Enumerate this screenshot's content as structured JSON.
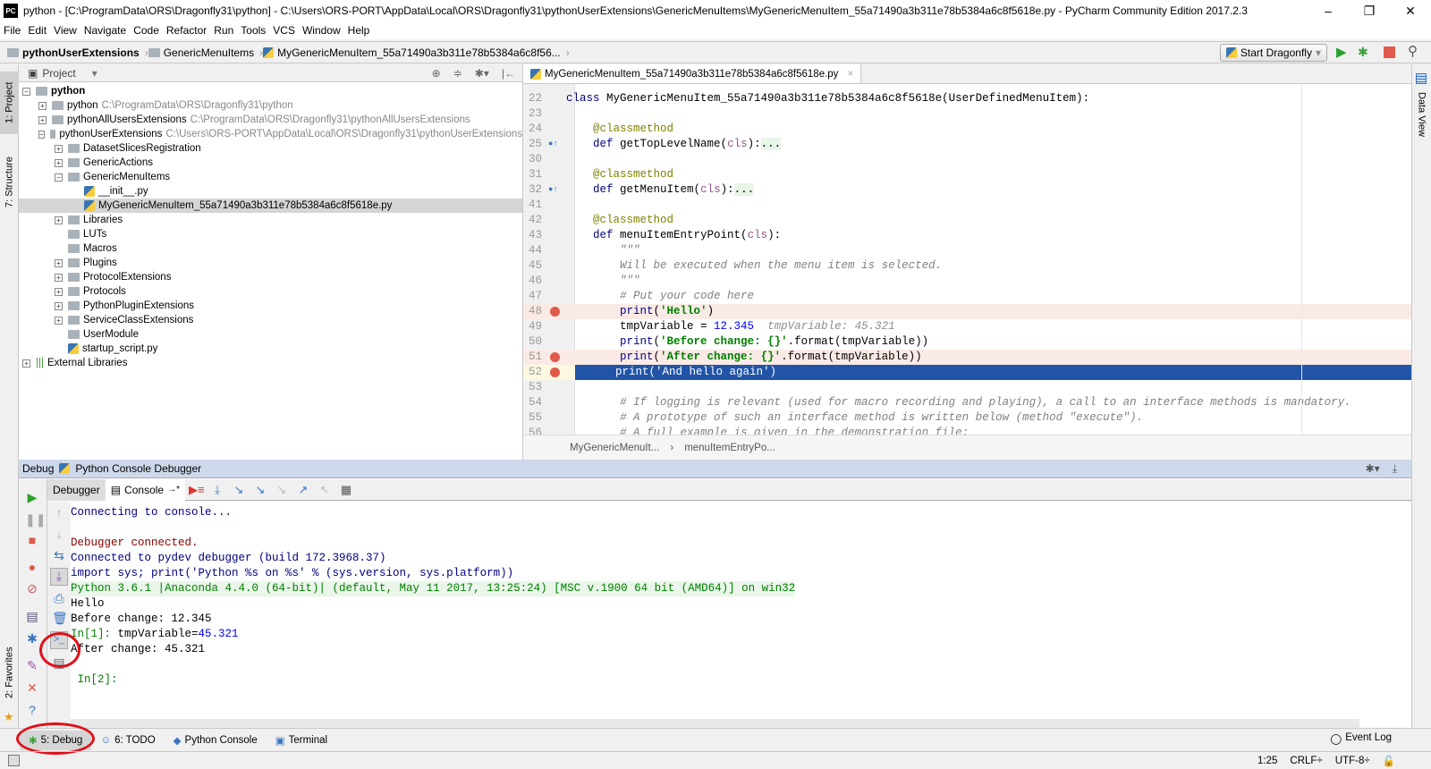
{
  "window": {
    "title": "python - [C:\\ProgramData\\ORS\\Dragonfly31\\python] - C:\\Users\\ORS-PORT\\AppData\\Local\\ORS\\Dragonfly31\\pythonUserExtensions\\GenericMenuItems\\MyGenericMenuItem_55a71490a3b311e78b5384a6c8f5618e.py - PyCharm Community Edition 2017.2.3",
    "logo": "PC",
    "minimize": "–",
    "maximize": "❐",
    "close": "✕"
  },
  "menu": [
    "File",
    "Edit",
    "View",
    "Navigate",
    "Code",
    "Refactor",
    "Run",
    "Tools",
    "VCS",
    "Window",
    "Help"
  ],
  "breadcrumb": [
    "pythonUserExtensions",
    "GenericMenuItems",
    "MyGenericMenuItem_55a71490a3b311e78b5384a6c8f56..."
  ],
  "run_config": {
    "label": "Start Dragonfly"
  },
  "left_strip": {
    "project": "1: Project",
    "structure": "7: Structure",
    "favorites": "2: Favorites"
  },
  "right_strip": {
    "data_view": "Data View"
  },
  "project": {
    "header": "Project",
    "tree": [
      {
        "label": "python",
        "path": "",
        "toggle": "−",
        "depth": 0,
        "bold": true
      },
      {
        "label": "python",
        "path": "C:\\ProgramData\\ORS\\Dragonfly31\\python",
        "toggle": "+",
        "depth": 1
      },
      {
        "label": "pythonAllUsersExtensions",
        "path": "C:\\ProgramData\\ORS\\Dragonfly31\\pythonAllUsersExtensions",
        "toggle": "+",
        "depth": 1
      },
      {
        "label": "pythonUserExtensions",
        "path": "C:\\Users\\ORS-PORT\\AppData\\Local\\ORS\\Dragonfly31\\pythonUserExtensions",
        "toggle": "−",
        "depth": 1
      },
      {
        "label": "DatasetSlicesRegistration",
        "path": "",
        "toggle": "+",
        "depth": 2
      },
      {
        "label": "GenericActions",
        "path": "",
        "toggle": "+",
        "depth": 2
      },
      {
        "label": "GenericMenuItems",
        "path": "",
        "toggle": "−",
        "depth": 2
      },
      {
        "label": "__init__.py",
        "path": "",
        "toggle": "",
        "depth": 3,
        "file": true
      },
      {
        "label": "MyGenericMenuItem_55a71490a3b311e78b5384a6c8f5618e.py",
        "path": "",
        "toggle": "",
        "depth": 3,
        "file": true,
        "selected": true
      },
      {
        "label": "Libraries",
        "path": "",
        "toggle": "+",
        "depth": 2
      },
      {
        "label": "LUTs",
        "path": "",
        "toggle": "",
        "depth": 2
      },
      {
        "label": "Macros",
        "path": "",
        "toggle": "",
        "depth": 2
      },
      {
        "label": "Plugins",
        "path": "",
        "toggle": "+",
        "depth": 2
      },
      {
        "label": "ProtocolExtensions",
        "path": "",
        "toggle": "+",
        "depth": 2
      },
      {
        "label": "Protocols",
        "path": "",
        "toggle": "+",
        "depth": 2
      },
      {
        "label": "PythonPluginExtensions",
        "path": "",
        "toggle": "+",
        "depth": 2
      },
      {
        "label": "ServiceClassExtensions",
        "path": "",
        "toggle": "+",
        "depth": 2
      },
      {
        "label": "UserModule",
        "path": "",
        "toggle": "",
        "depth": 2
      },
      {
        "label": "startup_script.py",
        "path": "",
        "toggle": "",
        "depth": 2,
        "file": true
      },
      {
        "label": "External Libraries",
        "path": "",
        "toggle": "+",
        "depth": 0,
        "lib": true
      }
    ]
  },
  "editor": {
    "tab": "MyGenericMenuItem_55a71490a3b311e78b5384a6c8f5618e.py",
    "lines": [
      {
        "n": "22",
        "html": "<span class='kw'>class</span> MyGenericMenuItem_55a71490a3b311e78b5384a6c8f5618e(UserDefinedMenuItem):"
      },
      {
        "n": "23",
        "html": ""
      },
      {
        "n": "24",
        "html": "    <span class='dec'>@classmethod</span>"
      },
      {
        "n": "25",
        "html": "    <span class='kw'>def</span> getTopLevelName(<span class='cls'>cls</span>):<span style='background:#e8f5e8'>...</span>",
        "mark": "override"
      },
      {
        "n": "30",
        "html": ""
      },
      {
        "n": "31",
        "html": "    <span class='dec'>@classmethod</span>"
      },
      {
        "n": "32",
        "html": "    <span class='kw'>def</span> getMenuItem(<span class='cls'>cls</span>):<span style='background:#e8f5e8'>...</span>",
        "mark": "override"
      },
      {
        "n": "41",
        "html": ""
      },
      {
        "n": "42",
        "html": "    <span class='dec'>@classmethod</span>"
      },
      {
        "n": "43",
        "html": "    <span class='kw'>def</span> menuItemEntryPoint(<span class='cls'>cls</span>):"
      },
      {
        "n": "44",
        "html": "        <span class='cm'>\"\"\"</span>"
      },
      {
        "n": "45",
        "html": "        <span class='cm'>Will be executed when the menu item is selected.</span>"
      },
      {
        "n": "46",
        "html": "        <span class='cm'>\"\"\"</span>"
      },
      {
        "n": "47",
        "html": "        <span class='cm'># Put your code here</span>"
      },
      {
        "n": "48",
        "html": "        <span class='kw'>print</span>(<span class='str'>'Hello'</span>)",
        "bp": true
      },
      {
        "n": "49",
        "html": "        tmpVariable = <span class='num'>12.345</span>  <span class='inl'>tmpVariable: 45.321</span>"
      },
      {
        "n": "50",
        "html": "        <span class='kw'>print</span>(<span class='str'>'Before change: {}'</span>.format(tmpVariable))"
      },
      {
        "n": "51",
        "html": "        <span class='kw'>print</span>(<span class='str'>'After change: {}'</span>.format(tmpVariable))",
        "bp": true
      },
      {
        "n": "52",
        "html": "        print('And hello again')",
        "bp": true,
        "current": true
      },
      {
        "n": "53",
        "html": ""
      },
      {
        "n": "54",
        "html": "        <span class='cm'># If logging is relevant (used for macro recording and playing), a call to an interface methods is mandatory.</span>"
      },
      {
        "n": "55",
        "html": "        <span class='cm'># A prototype of such an interface method is written below (method \"execute\").</span>"
      },
      {
        "n": "56",
        "html": "        <span class='cm'># A full example is given in the demonstration file:</span>"
      }
    ],
    "crumbs": [
      "MyGenericMenuIt...",
      "menuItemEntryPo..."
    ]
  },
  "debug": {
    "label": "Debug",
    "config": "Python Console Debugger",
    "tabs": {
      "debugger": "Debugger",
      "console": "Console"
    },
    "console": [
      {
        "text": "Connecting to console...",
        "color": "#000080"
      },
      {
        "text": "",
        "color": "#000"
      },
      {
        "text": "Debugger connected.",
        "color": "#8b0000"
      },
      {
        "text": "Connected to pydev debugger (build 172.3968.37)",
        "color": "#000080"
      },
      {
        "text": "import sys; print('Python %s on %s' % (sys.version, sys.platform))",
        "color": "#000080"
      },
      {
        "text": "Python 3.6.1 |Anaconda 4.4.0 (64-bit)| (default, May 11 2017, 13:25:24) [MSC v.1900 64 bit (AMD64)] on win32",
        "color": "#008000",
        "bg": "#eaf6ea"
      },
      {
        "text": "Hello",
        "color": "#000"
      },
      {
        "text": "Before change: 12.345",
        "color": "#000"
      },
      {
        "prompt": "In[1]: ",
        "text": "tmpVariable=",
        "value": "45.321",
        "color": "#000"
      },
      {
        "text": "After change: 45.321",
        "color": "#000"
      },
      {
        "text": "",
        "color": "#000"
      },
      {
        "prompt": " In[2]:",
        "text": "",
        "color": "#000"
      }
    ]
  },
  "bottom_tabs": [
    {
      "label": "5: Debug",
      "icon": "bug-icon",
      "active": true
    },
    {
      "label": "6: TODO",
      "icon": "todo-icon"
    },
    {
      "label": "Python Console",
      "icon": "python-icon"
    },
    {
      "label": "Terminal",
      "icon": "terminal-icon"
    }
  ],
  "event_log": "Event Log",
  "status": {
    "position": "1:25",
    "line_sep": "CRLF÷",
    "encoding": "UTF-8÷"
  },
  "colors": {
    "current_line": "#2154a6",
    "breakpoint": "#e05a4a",
    "annotation_circle": "#e0101a"
  }
}
